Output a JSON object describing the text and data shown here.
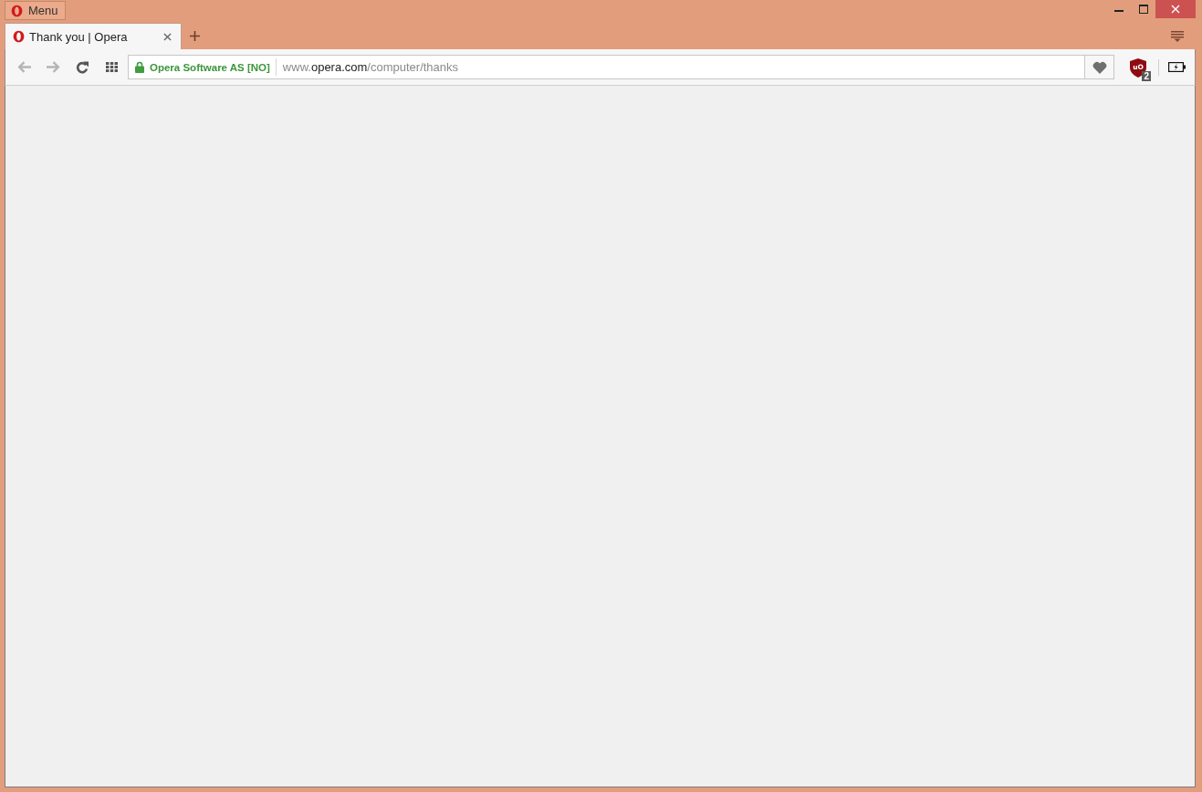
{
  "window": {
    "menu_label": "Menu",
    "controls": [
      {
        "kind": "minimize"
      },
      {
        "kind": "maximize"
      },
      {
        "kind": "close"
      }
    ]
  },
  "tabs": [
    {
      "title": "Thank you | Opera",
      "selected": true
    }
  ],
  "toolbar": {
    "nav_buttons": [
      {
        "kind": "back",
        "disabled": true
      },
      {
        "kind": "forward",
        "disabled": true
      },
      {
        "kind": "reload",
        "disabled": false
      },
      {
        "kind": "speed-dial",
        "disabled": false
      }
    ],
    "address_bar": {
      "secure": true,
      "certificate": "Opera Software AS [NO]",
      "url": {
        "prefix": "www.",
        "domain": "opera.com",
        "path": "/computer/thanks"
      }
    },
    "extensions": [
      {
        "kind": "shield",
        "logo_text": "uO",
        "badge": "2"
      },
      {
        "kind": "battery"
      }
    ]
  }
}
